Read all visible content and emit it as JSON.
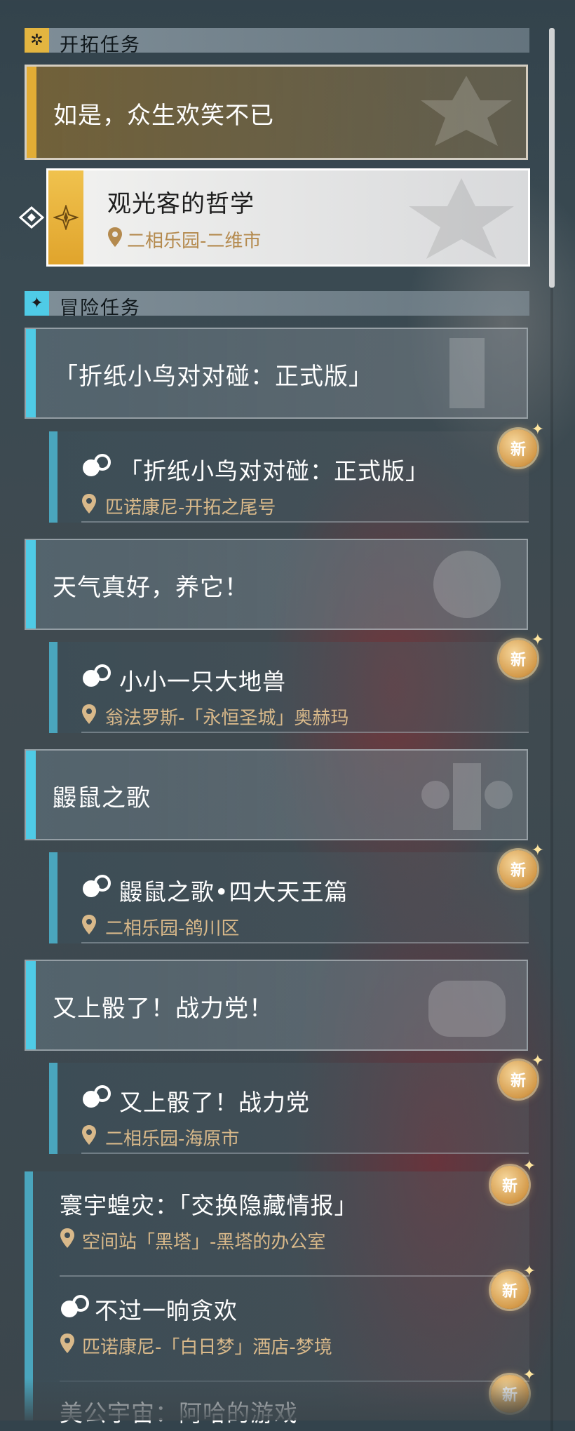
{
  "sections": {
    "trailblaze": {
      "title": "开拓任务",
      "icon": "compass-star-icon"
    },
    "adventure": {
      "title": "冒险任务",
      "icon": "four-point-star-icon"
    }
  },
  "trailblaze_group": {
    "title": "如是，众生欢笑不已",
    "active_quest": {
      "title": "观光客的哲学",
      "location": "二相乐园-二维市"
    }
  },
  "adventure_groups": [
    {
      "title": "「折纸小鸟对对碰：正式版」",
      "quest": {
        "title": "「折纸小鸟对对碰：正式版」",
        "location": "匹诺康尼-开拓之尾号",
        "badge": "新"
      }
    },
    {
      "title": "天气真好，养它！",
      "quest": {
        "title": "小小一只大地兽",
        "location": "翁法罗斯-「永恒圣城」奥赫玛",
        "badge": "新"
      }
    },
    {
      "title": "鼹鼠之歌",
      "quest": {
        "title": "鼹鼠之歌•四大天王篇",
        "location": "二相乐园-鸽川区",
        "badge": "新"
      }
    },
    {
      "title": "又上骰了！战力党！",
      "quest": {
        "title": "又上骰了！战力党",
        "location": "二相乐园-海原市",
        "badge": "新"
      }
    }
  ],
  "standalone_quests": [
    {
      "title": "寰宇蝗灾：「交换隐藏情报」",
      "location": "空间站「黑塔」-黑塔的办公室",
      "badge": "新"
    },
    {
      "title": "不过一晌贪欢",
      "location": "匹诺康尼-「白日梦」酒店-梦境",
      "badge": "新"
    },
    {
      "title": "美公宇宙：阿哈的游戏",
      "location": "",
      "badge": "新"
    }
  ],
  "colors": {
    "trailblaze_accent": "#e3b540",
    "adventure_accent": "#4fcbe6",
    "location_text": "#d9b98a"
  }
}
